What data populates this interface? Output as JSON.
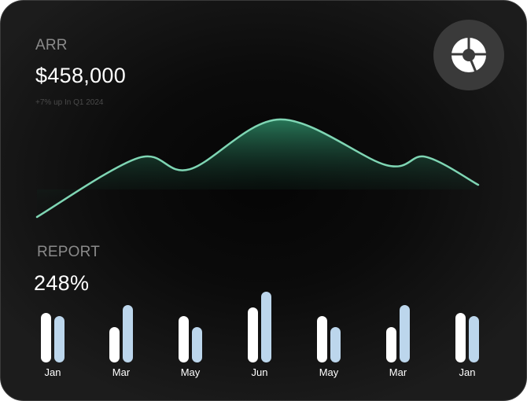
{
  "arr": {
    "label": "ARR",
    "value": "$458,000",
    "subtext": "+7% up In Q1 2024"
  },
  "report": {
    "label": "REPORT",
    "value": "248%"
  },
  "icon": "pie-chart-icon",
  "colors": {
    "accent": "#7fd6b4",
    "bar_primary": "#ffffff",
    "bar_secondary": "#bcd6ec",
    "background": "#0b0b0b"
  },
  "chart_data": [
    {
      "type": "area",
      "series_levels": [
        0.0,
        0.57,
        0.46,
        0.94,
        0.5,
        0.58,
        0.31
      ]
    },
    {
      "type": "bar",
      "categories": [
        "Jan",
        "Mar",
        "May",
        "Jun",
        "May",
        "Mar",
        "Jan"
      ],
      "series": [
        {
          "values": [
            0.7,
            0.5,
            0.66,
            0.78,
            0.66,
            0.5,
            0.7
          ]
        },
        {
          "values": [
            0.66,
            0.81,
            0.5,
            1.0,
            0.5,
            0.81,
            0.66
          ]
        }
      ]
    }
  ]
}
